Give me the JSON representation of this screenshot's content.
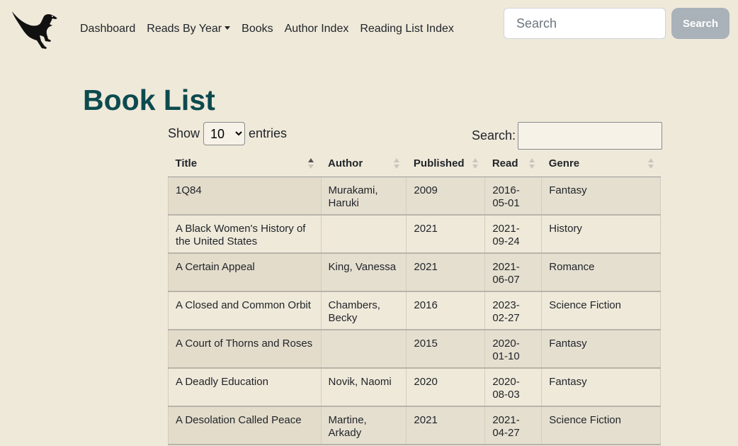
{
  "nav": {
    "links": [
      "Dashboard",
      "Reads By Year",
      "Books",
      "Author Index",
      "Reading List Index"
    ],
    "search_placeholder": "Search",
    "search_button": "Search"
  },
  "page": {
    "title": "Book List"
  },
  "table_controls": {
    "show_label": "Show",
    "entries_value": "10",
    "entries_label": "entries",
    "search_label": "Search:"
  },
  "table": {
    "headers": [
      "Title",
      "Author",
      "Published",
      "Read",
      "Genre"
    ],
    "sorted_column": "Title",
    "rows": [
      [
        "1Q84",
        "Murakami, Haruki",
        "2009",
        "2016-05-01",
        "Fantasy"
      ],
      [
        "A Black Women's History of the United States",
        "",
        "2021",
        "2021-09-24",
        "History"
      ],
      [
        "A Certain Appeal",
        "King, Vanessa",
        "2021",
        "2021-06-07",
        "Romance"
      ],
      [
        "A Closed and Common Orbit",
        "Chambers, Becky",
        "2016",
        "2023-02-27",
        "Science Fiction"
      ],
      [
        "A Court of Thorns and Roses",
        "",
        "2015",
        "2020-01-10",
        "Fantasy"
      ],
      [
        "A Deadly Education",
        "Novik, Naomi",
        "2020",
        "2020-08-03",
        "Fantasy"
      ],
      [
        "A Desolation Called Peace",
        "Martine, Arkady",
        "2021",
        "2021-04-27",
        "Science Fiction"
      ]
    ]
  }
}
